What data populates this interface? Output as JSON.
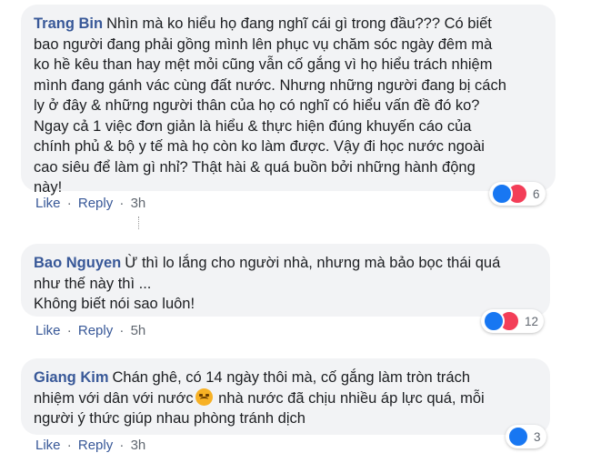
{
  "comments": [
    {
      "author": "Trang Bin",
      "lines": [
        "Nhìn mà ko hiểu họ đang nghĩ cái gì trong đầu??? Có biết",
        "bao người đang phải gồng mình lên phục vụ chăm sóc ngày đêm mà",
        "ko hề kêu than hay mệt mỏi cũng vẫn cố gắng vì họ hiểu trách nhiệm",
        "mình đang gánh vác cùng đất nước. Nhưng những người đang bị cách",
        "ly ở đây & những người thân của họ có nghĩ có hiểu vấn đề đó ko?",
        "Ngay cả 1 việc đơn giản là hiểu & thực hiện đúng khuyến cáo của",
        "chính phủ & bộ y tế mà họ còn ko làm được. Vậy đi học nước ngoài",
        "cao siêu để làm gì nhỉ? Thật hài & quá buồn bởi những hành động",
        "này!"
      ],
      "like_label": "Like",
      "reply_label": "Reply",
      "time": "3h",
      "reaction_count": "6",
      "reactions": [
        "like-icon",
        "love-icon"
      ]
    },
    {
      "author": "Bao Nguyen",
      "lines": [
        "Ừ thì lo lắng cho người nhà, nhưng mà bảo bọc thái quá",
        "như thế này thì ...",
        "Không biết nói sao luôn!"
      ],
      "like_label": "Like",
      "reply_label": "Reply",
      "time": "5h",
      "reaction_count": "12",
      "reactions": [
        "like-icon",
        "love-icon"
      ]
    },
    {
      "author": "Giang Kim",
      "line1": "Chán ghê, có 14 ngày thôi mà, cố gắng làm tròn trách",
      "line2_before": "nhiệm với dân với nước",
      "line2_after": " nhà nước đã chịu nhiều áp lực quá, mỗi",
      "line3": "người ý thức giúp nhau phòng tránh dịch",
      "like_label": "Like",
      "reply_label": "Reply",
      "time": "3h",
      "reaction_count": "3",
      "reactions": [
        "like-icon"
      ],
      "emoji": "grimacing-face-emoji"
    }
  ],
  "separator": "·",
  "colors": {
    "author": "#385898",
    "bubble": "#f2f3f5",
    "like": "#1877f2",
    "love": "#f33e58"
  }
}
